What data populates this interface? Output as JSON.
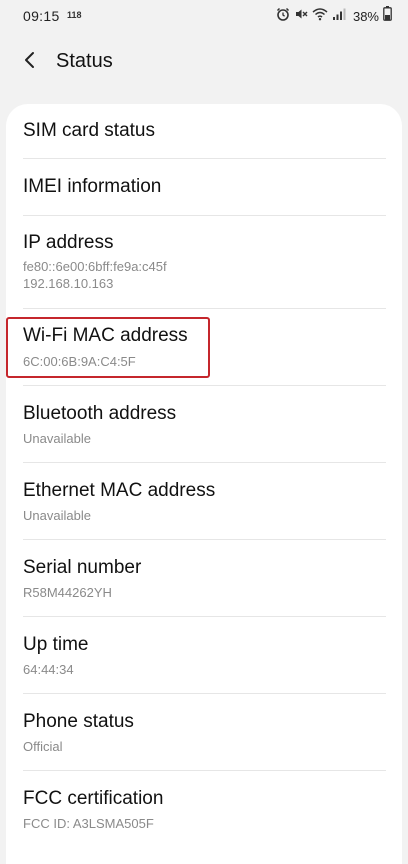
{
  "status_bar": {
    "time": "09:15",
    "notification": "118",
    "battery_percent": "38%",
    "icons": [
      "alarm-icon",
      "mute-icon",
      "wifi-icon",
      "signal-icon",
      "battery-icon"
    ]
  },
  "header": {
    "back_icon": "chevron-left-icon",
    "title": "Status"
  },
  "items": [
    {
      "title": "SIM card status",
      "sub": []
    },
    {
      "title": "IMEI information",
      "sub": []
    },
    {
      "title": "IP address",
      "sub": [
        "fe80::6e00:6bff:fe9a:c45f",
        "192.168.10.163"
      ]
    },
    {
      "title": "Wi-Fi MAC address",
      "sub": [
        "6C:00:6B:9A:C4:5F"
      ]
    },
    {
      "title": "Bluetooth address",
      "sub": [
        "Unavailable"
      ]
    },
    {
      "title": "Ethernet MAC address",
      "sub": [
        "Unavailable"
      ]
    },
    {
      "title": "Serial number",
      "sub": [
        "R58M44262YH"
      ]
    },
    {
      "title": "Up time",
      "sub": [
        "64:44:34"
      ]
    },
    {
      "title": "Phone status",
      "sub": [
        "Official"
      ]
    },
    {
      "title": "FCC certification",
      "sub": [
        "FCC ID: A3LSMA505F"
      ]
    }
  ],
  "colors": {
    "background": "#f2f2f2",
    "card": "#ffffff",
    "highlight": "#c5262c",
    "subtext": "#8a8a8a"
  }
}
